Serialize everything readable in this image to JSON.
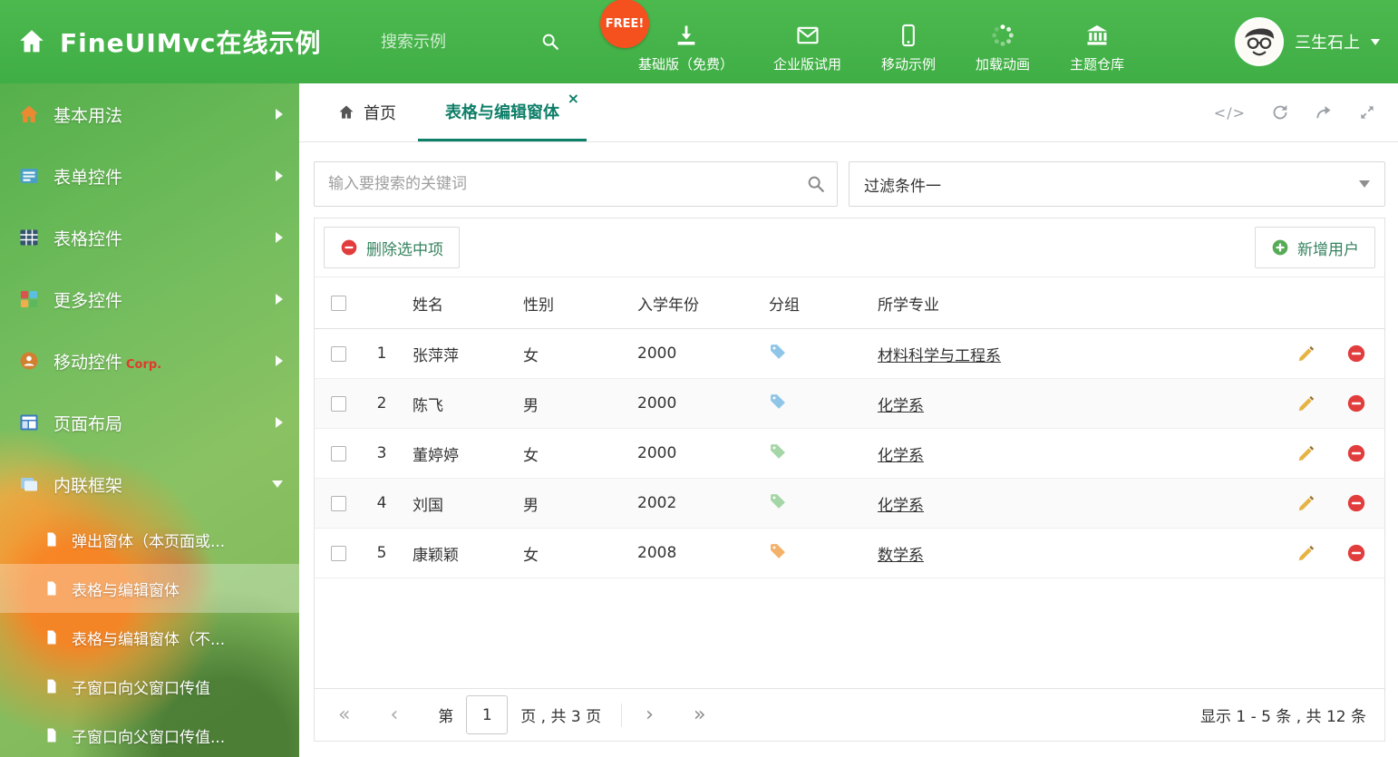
{
  "header": {
    "title": "FineUIMvc在线示例",
    "search_placeholder": "搜索示例",
    "free_badge": "FREE!",
    "nav_items": [
      {
        "icon": "download-icon",
        "label": "基础版（免费）"
      },
      {
        "icon": "mail-icon",
        "label": "企业版试用"
      },
      {
        "icon": "mobile-icon",
        "label": "移动示例"
      },
      {
        "icon": "spinner-icon",
        "label": "加载动画"
      },
      {
        "icon": "bank-icon",
        "label": "主题仓库"
      }
    ],
    "user_name": "三生石上"
  },
  "sidebar": {
    "items": [
      {
        "icon": "home-icon",
        "label": "基本用法"
      },
      {
        "icon": "form-icon",
        "label": "表单控件"
      },
      {
        "icon": "grid-icon",
        "label": "表格控件"
      },
      {
        "icon": "blocks-icon",
        "label": "更多控件"
      },
      {
        "icon": "mobile-icon",
        "label": "移动控件",
        "badge": "Corp."
      },
      {
        "icon": "layout-icon",
        "label": "页面布局"
      },
      {
        "icon": "frame-icon",
        "label": "内联框架"
      }
    ],
    "subitems": [
      {
        "label": "弹出窗体（本页面或..."
      },
      {
        "label": "表格与编辑窗体"
      },
      {
        "label": "表格与编辑窗体（不..."
      },
      {
        "label": "子窗口向父窗口传值"
      },
      {
        "label": "子窗口向父窗口传值..."
      }
    ]
  },
  "tabs": {
    "home_label": "首页",
    "active_label": "表格与编辑窗体"
  },
  "icons": {
    "close": "×",
    "code": "</>"
  },
  "filter": {
    "search_placeholder": "输入要搜索的关键词",
    "dropdown_value": "过滤条件一"
  },
  "grid": {
    "delete_button": "删除选中项",
    "add_button": "新增用户",
    "columns": {
      "name": "姓名",
      "gender": "性别",
      "year": "入学年份",
      "group": "分组",
      "major": "所学专业"
    },
    "rows": [
      {
        "no": "1",
        "name": "张萍萍",
        "gender": "女",
        "year": "2000",
        "tag_color": "#8fc6e8",
        "major": "材料科学与工程系"
      },
      {
        "no": "2",
        "name": "陈飞",
        "gender": "男",
        "year": "2000",
        "tag_color": "#8fc6e8",
        "major": "化学系"
      },
      {
        "no": "3",
        "name": "董婷婷",
        "gender": "女",
        "year": "2000",
        "tag_color": "#a5d6a7",
        "major": "化学系"
      },
      {
        "no": "4",
        "name": "刘国",
        "gender": "男",
        "year": "2002",
        "tag_color": "#a5d6a7",
        "major": "化学系"
      },
      {
        "no": "5",
        "name": "康颖颖",
        "gender": "女",
        "year": "2008",
        "tag_color": "#f4b169",
        "major": "数学系"
      }
    ],
    "pagination": {
      "first": "«",
      "prev": "‹",
      "page_label": "第",
      "current": "1",
      "total_label": "页 , 共 3 页",
      "next": "›",
      "last": "»",
      "summary": "显示 1 - 5 条 , 共 12 条"
    }
  },
  "colors": {
    "header_green": "#45b549",
    "accent_teal": "#0e7f68",
    "free_red": "#f4511e",
    "delete_red": "#e23d3d",
    "add_green": "#57ab57",
    "pencil_gold": "#e6b345"
  }
}
